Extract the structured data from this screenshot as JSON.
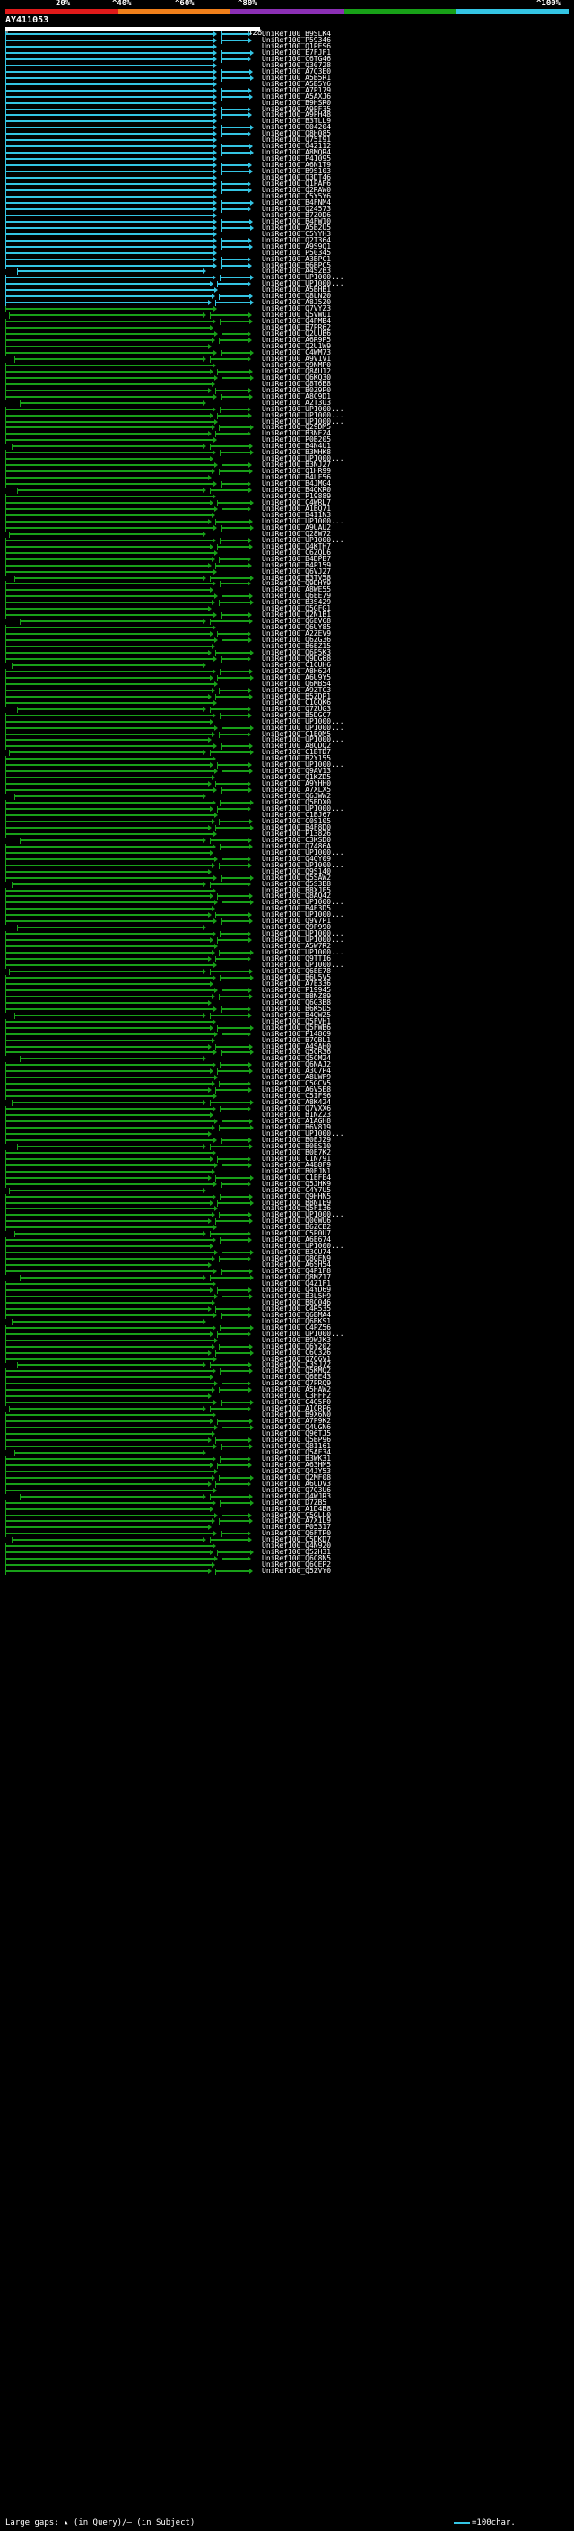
{
  "scale": {
    "labels": [
      "20%",
      "^40%",
      "^60%",
      "^80%",
      "^100%"
    ],
    "colors": [
      "#e01a1a",
      "#f07f1a",
      "#8b2fb4",
      "#18a018",
      "#34c5e4"
    ]
  },
  "query": {
    "name": "AY411053",
    "start": "1",
    "end": "428"
  },
  "footer": {
    "left": "Large gaps: ▴ (in Query)/— (in Subject)",
    "right": "=100char."
  },
  "hits": [
    {
      "label": "UniRef100_B9SLK4",
      "color": "#34c5e4"
    },
    {
      "label": "UniRef100_P59346",
      "color": "#34c5e4"
    },
    {
      "label": "UniRef100_Q1PES6",
      "color": "#34c5e4"
    },
    {
      "label": "UniRef100_E7FJF1",
      "color": "#34c5e4"
    },
    {
      "label": "UniRef100_C6TG46",
      "color": "#34c5e4"
    },
    {
      "label": "UniRef100_Q30728",
      "color": "#34c5e4"
    },
    {
      "label": "UniRef100_A7Q3E0",
      "color": "#34c5e4"
    },
    {
      "label": "UniRef100_A5B5R1",
      "color": "#34c5e4"
    },
    {
      "label": "UniRef100_A5B5Y6",
      "color": "#34c5e4"
    },
    {
      "label": "UniRef100_A7P179",
      "color": "#34c5e4"
    },
    {
      "label": "UniRef100_A5AXJ6",
      "color": "#34c5e4"
    },
    {
      "label": "UniRef100_B9HSR0",
      "color": "#34c5e4"
    },
    {
      "label": "UniRef100_A9PF35",
      "color": "#34c5e4"
    },
    {
      "label": "UniRef100_A9PH48",
      "color": "#34c5e4"
    },
    {
      "label": "UniRef100_B3TLL9",
      "color": "#34c5e4"
    },
    {
      "label": "UniRef100_O04204",
      "color": "#34c5e4"
    },
    {
      "label": "UniRef100_Q8H085",
      "color": "#34c5e4"
    },
    {
      "label": "UniRef100_Q75I91",
      "color": "#34c5e4"
    },
    {
      "label": "UniRef100_O42112",
      "color": "#34c5e4"
    },
    {
      "label": "UniRef100_A8MQR4",
      "color": "#34c5e4"
    },
    {
      "label": "UniRef100_P41095",
      "color": "#34c5e4"
    },
    {
      "label": "UniRef100_A6N1T9",
      "color": "#34c5e4"
    },
    {
      "label": "UniRef100_B9S103",
      "color": "#34c5e4"
    },
    {
      "label": "UniRef100_Q3DT46",
      "color": "#34c5e4"
    },
    {
      "label": "UniRef100_Q1PAF6",
      "color": "#34c5e4"
    },
    {
      "label": "UniRef100_Q2RAW0",
      "color": "#34c5e4"
    },
    {
      "label": "UniRef100_C5Y5Y6",
      "color": "#34c5e4"
    },
    {
      "label": "UniRef100_B4FNM4",
      "color": "#34c5e4"
    },
    {
      "label": "UniRef100_Q24573",
      "color": "#34c5e4"
    },
    {
      "label": "UniRef100_B7Z0D6",
      "color": "#34c5e4"
    },
    {
      "label": "UniRef100_B4FW10",
      "color": "#34c5e4"
    },
    {
      "label": "UniRef100_A5B2U5",
      "color": "#34c5e4"
    },
    {
      "label": "UniRef100_C5YYH3",
      "color": "#34c5e4"
    },
    {
      "label": "UniRef100_Q2T364",
      "color": "#34c5e4"
    },
    {
      "label": "UniRef100_A9S9Q1",
      "color": "#34c5e4"
    },
    {
      "label": "UniRef100_P50345",
      "color": "#34c5e4"
    },
    {
      "label": "UniRef100_A3BPC1",
      "color": "#34c5e4"
    },
    {
      "label": "UniRef100_B6BPC5",
      "color": "#34c5e4"
    },
    {
      "label": "UniRef100_A4S2B3",
      "color": "#34c5e4"
    },
    {
      "label": "UniRef100_UP1000...",
      "color": "#34c5e4"
    },
    {
      "label": "UniRef100_UP1000...",
      "color": "#34c5e4"
    },
    {
      "label": "UniRef100_A5BHB1",
      "color": "#34c5e4"
    },
    {
      "label": "UniRef100_Q8LN20",
      "color": "#34c5e4"
    },
    {
      "label": "UniRef100_A8J5Z0",
      "color": "#34c5e4"
    },
    {
      "label": "UniRef100_Q7VYZ3",
      "color": "#18a018"
    },
    {
      "label": "UniRef100_Q5VWU1",
      "color": "#18a018"
    },
    {
      "label": "UniRef100_Q4PMB4",
      "color": "#18a018"
    },
    {
      "label": "UniRef100_B7PR62",
      "color": "#18a018"
    },
    {
      "label": "UniRef100_Q2UUB6",
      "color": "#18a018"
    },
    {
      "label": "UniRef100_A6R9P5",
      "color": "#18a018"
    },
    {
      "label": "UniRef100_Q2U1W9",
      "color": "#18a018"
    },
    {
      "label": "UniRef100_C4WM73",
      "color": "#18a018"
    },
    {
      "label": "UniRef100_A9V1V1",
      "color": "#18a018"
    },
    {
      "label": "UniRef100_Q9NMP0",
      "color": "#18a018"
    },
    {
      "label": "UniRef100_Q8AU12",
      "color": "#18a018"
    },
    {
      "label": "UniRef100_Q6KQ30",
      "color": "#18a018"
    },
    {
      "label": "UniRef100_Q8T6B8",
      "color": "#18a018"
    },
    {
      "label": "UniRef100_B0Z9P0",
      "color": "#18a018"
    },
    {
      "label": "UniRef100_A8C9D1",
      "color": "#18a018"
    },
    {
      "label": "UniRef100_A2T3U3",
      "color": "#18a018"
    },
    {
      "label": "UniRef100_UP1000...",
      "color": "#18a018"
    },
    {
      "label": "UniRef100_UP1000...",
      "color": "#18a018"
    },
    {
      "label": "UniRef100_UP1000...",
      "color": "#18a018"
    },
    {
      "label": "UniRef100_Q29DM5",
      "color": "#18a018"
    },
    {
      "label": "UniRef100_B3NEZ4",
      "color": "#18a018"
    },
    {
      "label": "UniRef100_P0B205",
      "color": "#18a018"
    },
    {
      "label": "UniRef100_B4N4U1",
      "color": "#18a018"
    },
    {
      "label": "UniRef100_B3MHK8",
      "color": "#18a018"
    },
    {
      "label": "UniRef100_UP1000...",
      "color": "#18a018"
    },
    {
      "label": "UniRef100_B3NJ27",
      "color": "#18a018"
    },
    {
      "label": "UniRef100_Q1HR99",
      "color": "#18a018"
    },
    {
      "label": "UniRef100_B4LF56",
      "color": "#18a018"
    },
    {
      "label": "UniRef100_B4JMG4",
      "color": "#18a018"
    },
    {
      "label": "UniRef100_B4QKR0",
      "color": "#18a018"
    },
    {
      "label": "UniRef100_P19889",
      "color": "#18a018"
    },
    {
      "label": "UniRef100_C4WRL7",
      "color": "#18a018"
    },
    {
      "label": "UniRef100_A1BQ71",
      "color": "#18a018"
    },
    {
      "label": "UniRef100_B4I1N3",
      "color": "#18a018"
    },
    {
      "label": "UniRef100_UP1000...",
      "color": "#18a018"
    },
    {
      "label": "UniRef100_A9UAU2",
      "color": "#18a018"
    },
    {
      "label": "UniRef100_Q28W72",
      "color": "#18a018"
    },
    {
      "label": "UniRef100_UP1000...",
      "color": "#18a018"
    },
    {
      "label": "UniRef100_Q4KTH7",
      "color": "#18a018"
    },
    {
      "label": "UniRef100_C6ZQL6",
      "color": "#18a018"
    },
    {
      "label": "UniRef100_B4DPB7",
      "color": "#18a018"
    },
    {
      "label": "UniRef100_B4P159",
      "color": "#18a018"
    },
    {
      "label": "UniRef100_Q6VJ27",
      "color": "#18a018"
    },
    {
      "label": "UniRef100_B3TV58",
      "color": "#18a018"
    },
    {
      "label": "UniRef100_Q9DHY9",
      "color": "#18a018"
    },
    {
      "label": "UniRef100_A8WE55",
      "color": "#18a018"
    },
    {
      "label": "UniRef100_Q6EE79",
      "color": "#18a018"
    },
    {
      "label": "UniRef100_B3S429",
      "color": "#18a018"
    },
    {
      "label": "UniRef100_Q5GFG1",
      "color": "#18a018"
    },
    {
      "label": "UniRef100_Q2N1B1",
      "color": "#18a018"
    },
    {
      "label": "UniRef100_Q6EV68",
      "color": "#18a018"
    },
    {
      "label": "UniRef100_Q6UY85",
      "color": "#18a018"
    },
    {
      "label": "UniRef100_A2ZEV9",
      "color": "#18a018"
    },
    {
      "label": "UniRef100_Q6ZG36",
      "color": "#18a018"
    },
    {
      "label": "UniRef100_B6EZ15",
      "color": "#18a018"
    },
    {
      "label": "UniRef100_Q6P5K3",
      "color": "#18a018"
    },
    {
      "label": "UniRef100_Q9DG68",
      "color": "#18a018"
    },
    {
      "label": "UniRef100_C1CUH6",
      "color": "#18a018"
    },
    {
      "label": "UniRef100_A8H624",
      "color": "#18a018"
    },
    {
      "label": "UniRef100_A6U9Y5",
      "color": "#18a018"
    },
    {
      "label": "UniRef100_Q6MB54",
      "color": "#18a018"
    },
    {
      "label": "UniRef100_A9ZTC3",
      "color": "#18a018"
    },
    {
      "label": "UniRef100_B5ZDP1",
      "color": "#18a018"
    },
    {
      "label": "UniRef100_C1GQK6",
      "color": "#18a018"
    },
    {
      "label": "UniRef100_Q7ZUG3",
      "color": "#18a018"
    },
    {
      "label": "UniRef100_B5DGC7",
      "color": "#18a018"
    },
    {
      "label": "UniRef100_UP1000...",
      "color": "#18a018"
    },
    {
      "label": "UniRef100_UP1000...",
      "color": "#18a018"
    },
    {
      "label": "UniRef100_C1E0M5",
      "color": "#18a018"
    },
    {
      "label": "UniRef100_UP1000...",
      "color": "#18a018"
    },
    {
      "label": "UniRef100_A8QDQ2",
      "color": "#18a018"
    },
    {
      "label": "UniRef100_C1BTD7",
      "color": "#18a018"
    },
    {
      "label": "UniRef100_B2Y155",
      "color": "#18a018"
    },
    {
      "label": "UniRef100_UP1000...",
      "color": "#18a018"
    },
    {
      "label": "UniRef100_Q9AV13",
      "color": "#18a018"
    },
    {
      "label": "UniRef100_Q1KZD5",
      "color": "#18a018"
    },
    {
      "label": "UniRef100_A9YHH0",
      "color": "#18a018"
    },
    {
      "label": "UniRef100_A7XLX5",
      "color": "#18a018"
    },
    {
      "label": "UniRef100_Q6JWW2",
      "color": "#18a018"
    },
    {
      "label": "UniRef100_Q5BDX0",
      "color": "#18a018"
    },
    {
      "label": "UniRef100_UP1000...",
      "color": "#18a018"
    },
    {
      "label": "UniRef100_C1BJ67",
      "color": "#18a018"
    },
    {
      "label": "UniRef100_C0S105",
      "color": "#18a018"
    },
    {
      "label": "UniRef100_B4F8D0",
      "color": "#18a018"
    },
    {
      "label": "UniRef100_P13826",
      "color": "#18a018"
    },
    {
      "label": "UniRef100_C3KSD0",
      "color": "#18a018"
    },
    {
      "label": "UniRef100_Q7486A",
      "color": "#18a018"
    },
    {
      "label": "UniRef100_UP1000...",
      "color": "#18a018"
    },
    {
      "label": "UniRef100_Q4QY09",
      "color": "#18a018"
    },
    {
      "label": "UniRef100_UP1000...",
      "color": "#18a018"
    },
    {
      "label": "UniRef100_Q9S140",
      "color": "#18a018"
    },
    {
      "label": "UniRef100_Q5SAW2",
      "color": "#18a018"
    },
    {
      "label": "UniRef100_Q5S3B8",
      "color": "#18a018"
    },
    {
      "label": "UniRef100_B8XJF5",
      "color": "#18a018"
    },
    {
      "label": "UniRef100_Q8AQ42",
      "color": "#18a018"
    },
    {
      "label": "UniRef100_UP1000...",
      "color": "#18a018"
    },
    {
      "label": "UniRef100_B4E3D5",
      "color": "#18a018"
    },
    {
      "label": "UniRef100_UP1000...",
      "color": "#18a018"
    },
    {
      "label": "UniRef100_Q9V7P1",
      "color": "#18a018"
    },
    {
      "label": "UniRef100_Q9P990",
      "color": "#18a018"
    },
    {
      "label": "UniRef100_UP1000...",
      "color": "#18a018"
    },
    {
      "label": "UniRef100_UP1000...",
      "color": "#18a018"
    },
    {
      "label": "UniRef100_A5W7R2",
      "color": "#18a018"
    },
    {
      "label": "UniRef100_UP1000...",
      "color": "#18a018"
    },
    {
      "label": "UniRef100_Q9TTI6",
      "color": "#18a018"
    },
    {
      "label": "UniRef100_UP1000...",
      "color": "#18a018"
    },
    {
      "label": "UniRef100_Q6EE78",
      "color": "#18a018"
    },
    {
      "label": "UniRef100_B6U5V5",
      "color": "#18a018"
    },
    {
      "label": "UniRef100_A7E336",
      "color": "#18a018"
    },
    {
      "label": "UniRef100_P19945",
      "color": "#18a018"
    },
    {
      "label": "UniRef100_B8NZ89",
      "color": "#18a018"
    },
    {
      "label": "UniRef100_Q6G3B8",
      "color": "#18a018"
    },
    {
      "label": "UniRef100_B6K5D5",
      "color": "#18a018"
    },
    {
      "label": "UniRef100_B4QWZ5",
      "color": "#18a018"
    },
    {
      "label": "UniRef100_Q5FVH1",
      "color": "#18a018"
    },
    {
      "label": "UniRef100_Q5FWB6",
      "color": "#18a018"
    },
    {
      "label": "UniRef100_P14869",
      "color": "#18a018"
    },
    {
      "label": "UniRef100_B7QBL1",
      "color": "#18a018"
    },
    {
      "label": "UniRef100_A4SAH0",
      "color": "#18a018"
    },
    {
      "label": "UniRef100_Q5CR36",
      "color": "#18a018"
    },
    {
      "label": "UniRef100_Q5CM24",
      "color": "#18a018"
    },
    {
      "label": "UniRef100_Q6NAJ2",
      "color": "#18a018"
    },
    {
      "label": "UniRef100_A3C7P4",
      "color": "#18a018"
    },
    {
      "label": "UniRef100_A8LWF9",
      "color": "#18a018"
    },
    {
      "label": "UniRef100_C5GCV5",
      "color": "#18a018"
    },
    {
      "label": "UniRef100_A6V5E8",
      "color": "#18a018"
    },
    {
      "label": "UniRef100_C5IFS6",
      "color": "#18a018"
    },
    {
      "label": "UniRef100_A8K424",
      "color": "#18a018"
    },
    {
      "label": "UniRef100_Q7VXX6",
      "color": "#18a018"
    },
    {
      "label": "UniRef100_B1NZ23",
      "color": "#18a018"
    },
    {
      "label": "UniRef100_A1AGH8",
      "color": "#18a018"
    },
    {
      "label": "UniRef100_B6V819",
      "color": "#18a018"
    },
    {
      "label": "UniRef100_UP1000...",
      "color": "#18a018"
    },
    {
      "label": "UniRef100_B0EJZ9",
      "color": "#18a018"
    },
    {
      "label": "UniRef100_B0ES10",
      "color": "#18a018"
    },
    {
      "label": "UniRef100_B0E7K2",
      "color": "#18a018"
    },
    {
      "label": "UniRef100_C1N791",
      "color": "#18a018"
    },
    {
      "label": "UniRef100_A4B8F9",
      "color": "#18a018"
    },
    {
      "label": "UniRef100_B0EJN1",
      "color": "#18a018"
    },
    {
      "label": "UniRef100_C1EFE4",
      "color": "#18a018"
    },
    {
      "label": "UniRef100_Q5JHK9",
      "color": "#18a018"
    },
    {
      "label": "UniRef100_C4Y7U5",
      "color": "#18a018"
    },
    {
      "label": "UniRef100_Q9HHN5",
      "color": "#18a018"
    },
    {
      "label": "UniRef100_B8NIE9",
      "color": "#18a018"
    },
    {
      "label": "UniRef100_Q5FI36",
      "color": "#18a018"
    },
    {
      "label": "UniRef100_UP1000...",
      "color": "#18a018"
    },
    {
      "label": "UniRef100_Q00WU6",
      "color": "#18a018"
    },
    {
      "label": "UniRef100_B6ZCB2",
      "color": "#18a018"
    },
    {
      "label": "UniRef100_C5P0U7",
      "color": "#18a018"
    },
    {
      "label": "UniRef100_A6E674",
      "color": "#18a018"
    },
    {
      "label": "UniRef100_UP1000...",
      "color": "#18a018"
    },
    {
      "label": "UniRef100_B3GU74",
      "color": "#18a018"
    },
    {
      "label": "UniRef100_Q8GEN9",
      "color": "#18a018"
    },
    {
      "label": "UniRef100_A6SH54",
      "color": "#18a018"
    },
    {
      "label": "UniRef100_Q4P1F8",
      "color": "#18a018"
    },
    {
      "label": "UniRef100_Q8MZ17",
      "color": "#18a018"
    },
    {
      "label": "UniRef100_Q4Z1F1",
      "color": "#18a018"
    },
    {
      "label": "UniRef100_Q4YD69",
      "color": "#18a018"
    },
    {
      "label": "UniRef100_B3L5H9",
      "color": "#18a018"
    },
    {
      "label": "UniRef100_B8C046",
      "color": "#18a018"
    },
    {
      "label": "UniRef100_C4R535",
      "color": "#18a018"
    },
    {
      "label": "UniRef100_Q6BMA4",
      "color": "#18a018"
    },
    {
      "label": "UniRef100_Q6BKS1",
      "color": "#18a018"
    },
    {
      "label": "UniRef100_C4PZ56",
      "color": "#18a018"
    },
    {
      "label": "UniRef100_UP1000...",
      "color": "#18a018"
    },
    {
      "label": "UniRef100_B9WJK3",
      "color": "#18a018"
    },
    {
      "label": "UniRef100_Q6Y202",
      "color": "#18a018"
    },
    {
      "label": "UniRef100_C6C326",
      "color": "#18a018"
    },
    {
      "label": "UniRef100_Q7Q6V1",
      "color": "#18a018"
    },
    {
      "label": "UniRef100_C3SJ72",
      "color": "#18a018"
    },
    {
      "label": "UniRef100_Q5KMQ2",
      "color": "#18a018"
    },
    {
      "label": "UniRef100_Q6EE43",
      "color": "#18a018"
    },
    {
      "label": "UniRef100_Q7PRQ9",
      "color": "#18a018"
    },
    {
      "label": "UniRef100_A5HAW2",
      "color": "#18a018"
    },
    {
      "label": "UniRef100_C3HFF2",
      "color": "#18a018"
    },
    {
      "label": "UniRef100_C4Q5F0",
      "color": "#18a018"
    },
    {
      "label": "UniRef100_A1CRP6",
      "color": "#18a018"
    },
    {
      "label": "UniRef100_B9X6N0",
      "color": "#18a018"
    },
    {
      "label": "UniRef100_A7P9K2",
      "color": "#18a018"
    },
    {
      "label": "UniRef100_Q4UGN6",
      "color": "#18a018"
    },
    {
      "label": "UniRef100_Q96TJ5",
      "color": "#18a018"
    },
    {
      "label": "UniRef100_Q5BP96",
      "color": "#18a018"
    },
    {
      "label": "UniRef100_Q8I161",
      "color": "#18a018"
    },
    {
      "label": "UniRef100_Q5AF34",
      "color": "#18a018"
    },
    {
      "label": "UniRef100_B3WK31",
      "color": "#18a018"
    },
    {
      "label": "UniRef100_A63HM5",
      "color": "#18a018"
    },
    {
      "label": "UniRef100_Q4JY53",
      "color": "#18a018"
    },
    {
      "label": "UniRef100_Q2MF08",
      "color": "#18a018"
    },
    {
      "label": "UniRef100_A6UDV3",
      "color": "#18a018"
    },
    {
      "label": "UniRef100_Q7Q3U6",
      "color": "#18a018"
    },
    {
      "label": "UniRef100_Q4WJR3",
      "color": "#18a018"
    },
    {
      "label": "UniRef100_D7ZB5",
      "color": "#18a018"
    },
    {
      "label": "UniRef100_A1D4B8",
      "color": "#18a018"
    },
    {
      "label": "UniRef100_C5GLL0",
      "color": "#18a018"
    },
    {
      "label": "UniRef100_A7X1L9",
      "color": "#18a018"
    },
    {
      "label": "UniRef100_P05317",
      "color": "#18a018"
    },
    {
      "label": "UniRef100_Q6FTP0",
      "color": "#18a018"
    },
    {
      "label": "UniRef100_C5DKD7",
      "color": "#18a018"
    },
    {
      "label": "UniRef100_Q4N920",
      "color": "#18a018"
    },
    {
      "label": "UniRef100_Q52H31",
      "color": "#18a018"
    },
    {
      "label": "UniRef100_Q6C8N5",
      "color": "#18a018"
    },
    {
      "label": "UniRef100_Q6CEP2",
      "color": "#18a018"
    },
    {
      "label": "UniRef100_Q5ZVY0",
      "color": "#18a018"
    }
  ]
}
